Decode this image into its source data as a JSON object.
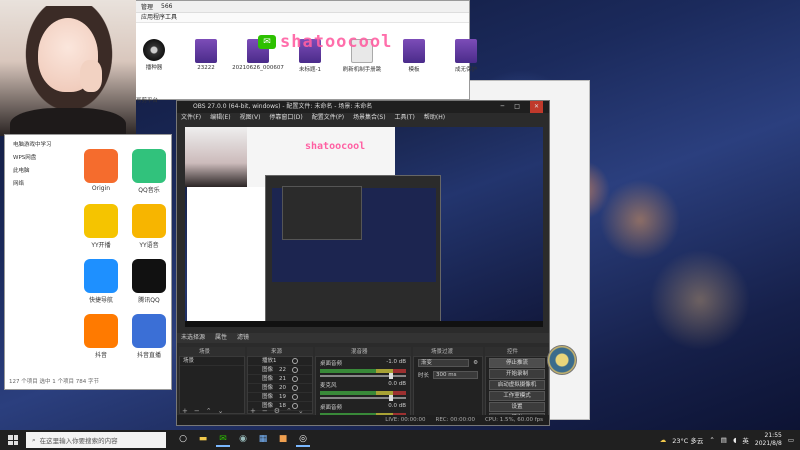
{
  "watermark": {
    "text": "shatoocool",
    "icon": "wechat-icon"
  },
  "explorer_top": {
    "tab_label": "管理",
    "tab_value": "566",
    "breadcrumb": "应用程序工具",
    "files": [
      {
        "name": "播种器",
        "icon": "disc-icon"
      },
      {
        "name": "23222",
        "icon": "rar-icon"
      },
      {
        "name": "20210626_000607",
        "icon": "rar-icon"
      },
      {
        "name": "未标题-1",
        "icon": "rar-icon"
      },
      {
        "name": "刷新机制手册跳",
        "icon": "pdf-icon"
      },
      {
        "name": "模板",
        "icon": "rar-icon"
      },
      {
        "name": "成无保护",
        "icon": "rar-icon"
      }
    ],
    "partial_label": "写剪平台"
  },
  "explorer_left": {
    "nav": [
      "电脑游戏中学习",
      "WPS网盘",
      "此电脑",
      "网络"
    ],
    "apps": [
      {
        "name": "Origin",
        "color": "#f56c2d"
      },
      {
        "name": "QQ音乐",
        "color": "#31c27c"
      },
      {
        "name": "YY开播",
        "color": "#f5c400"
      },
      {
        "name": "YY语音",
        "color": "#f7b500"
      },
      {
        "name": "快捷导航",
        "color": "#1e90ff"
      },
      {
        "name": "腾讯QQ",
        "color": "#111111"
      },
      {
        "name": "抖音",
        "color": "#ff7a00"
      },
      {
        "name": "抖音直播",
        "color": "#3b6fd6"
      }
    ],
    "status": "127 个项目  选中 1 个项目 784 字节"
  },
  "obs": {
    "title": "OBS 27.0.0 (64-bit, windows) - 配置文件: 未命名 - 场景: 未命名",
    "menu": [
      "文件(F)",
      "编辑(E)",
      "视图(V)",
      "停靠窗口(D)",
      "配置文件(P)",
      "场景集合(S)",
      "工具(T)",
      "帮助(H)"
    ],
    "controls_strip": [
      "未选择源",
      "属性",
      "滤镜"
    ],
    "docks": {
      "scenes": "场景",
      "sources": "来源",
      "mixer": "混音器",
      "transitions": "场景过渡",
      "controls": "控件"
    },
    "scenes": [
      "场景"
    ],
    "sources": [
      "播放1",
      "图像",
      "图像",
      "图像",
      "图像",
      "图像"
    ],
    "source_values": [
      "",
      "22",
      "21",
      "20",
      "19",
      "18"
    ],
    "mixer": [
      {
        "name": "桌面音频",
        "db": "-1.0 dB"
      },
      {
        "name": "麦克风",
        "db": "0.0 dB"
      },
      {
        "name": "桌面音频",
        "db": "0.0 dB"
      }
    ],
    "transition": {
      "label": "渐变",
      "duration_label": "时长",
      "duration": "300 ms"
    },
    "buttons": [
      "停止推流",
      "开始录制",
      "启动虚拟摄像机",
      "工作室模式",
      "设置",
      "退出"
    ],
    "status": [
      "LIVE: 00:00:00",
      "REC: 00:00:00",
      "CPU: 1.5%, 60.00 fps"
    ]
  },
  "taskbar": {
    "search_placeholder": "在这里输入你要搜索的内容",
    "weather": "23°C 多云",
    "lang": "英",
    "time": "21:55",
    "date": "2021/8/8"
  }
}
